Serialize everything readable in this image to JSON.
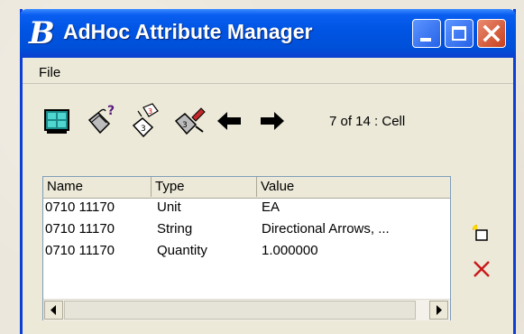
{
  "window": {
    "title": "AdHoc Attribute Manager",
    "app_icon": "B"
  },
  "menu": {
    "file": "File"
  },
  "toolbar": {
    "buttons": [
      {
        "icon": "grid-view-icon"
      },
      {
        "icon": "tag-query-icon"
      },
      {
        "icon": "tag-edit-icon"
      },
      {
        "icon": "tag-paint-icon"
      },
      {
        "icon": "arrow-left-icon"
      },
      {
        "icon": "arrow-right-icon"
      }
    ],
    "status": "7 of 14 : Cell"
  },
  "list": {
    "columns": [
      "Name",
      "Type",
      "Value"
    ],
    "rows": [
      {
        "name": "0710 11170",
        "type": "Unit",
        "value": "EA"
      },
      {
        "name": "0710 11170",
        "type": "String",
        "value": "Directional Arrows, ..."
      },
      {
        "name": "0710 11170",
        "type": "Quantity",
        "value": "1.000000"
      }
    ]
  },
  "side_actions": [
    {
      "icon": "new-attribute-icon"
    },
    {
      "icon": "delete-icon"
    }
  ],
  "colors": {
    "titlebar": "#0054e3",
    "close_button": "#c8401f",
    "dialog_bg": "#ece9d8"
  }
}
